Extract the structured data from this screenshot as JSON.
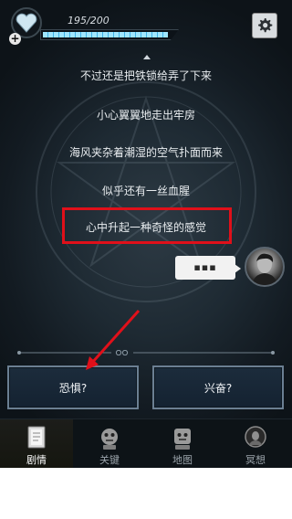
{
  "hud": {
    "energy_text": "195/200",
    "energy_fraction": 0.975
  },
  "story": {
    "lines": [
      "不过还是把铁锁给弄了下来",
      "小心翼翼地走出牢房",
      "海风夹杂着潮湿的空气扑面而来",
      "似乎还有一丝血腥",
      "心中升起一种奇怪的感觉"
    ],
    "player_bubble": "▪▪▪"
  },
  "choices": {
    "left": "恐惧?",
    "right": "兴奋?"
  },
  "nav": {
    "items": [
      {
        "label": "剧情",
        "icon": "story-book-icon"
      },
      {
        "label": "关键",
        "icon": "key-robot-icon"
      },
      {
        "label": "地图",
        "icon": "map-robot-icon"
      },
      {
        "label": "冥想",
        "icon": "meditate-portrait-icon"
      }
    ]
  },
  "colors": {
    "highlight": "#e0101a",
    "energy": "#3fb2e6",
    "choice_border": "#6b7f92"
  }
}
